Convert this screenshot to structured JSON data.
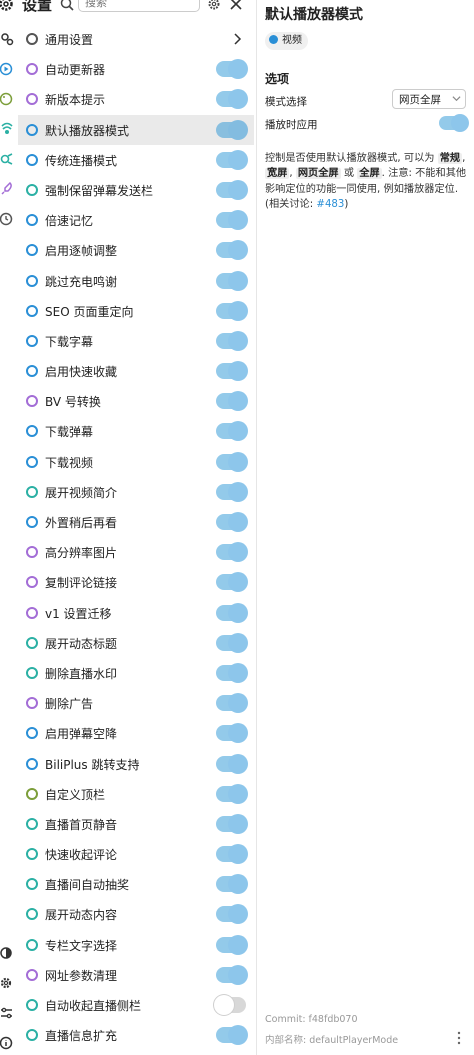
{
  "header": {
    "title": "设置",
    "search_placeholder": "搜索"
  },
  "list": [
    {
      "label": "通用设置",
      "ring": "#555555",
      "type": "nav"
    },
    {
      "label": "自动更新器",
      "ring": "#a36dd6",
      "type": "toggle",
      "on": true
    },
    {
      "label": "新版本提示",
      "ring": "#a36dd6",
      "type": "toggle",
      "on": true
    },
    {
      "label": "默认播放器模式",
      "ring": "#2a8fd6",
      "type": "toggle",
      "on": true,
      "active": true
    },
    {
      "label": "传统连播模式",
      "ring": "#2a8fd6",
      "type": "toggle",
      "on": true
    },
    {
      "label": "强制保留弹幕发送栏",
      "ring": "#2bb0a4",
      "type": "toggle",
      "on": true
    },
    {
      "label": "倍速记忆",
      "ring": "#2a8fd6",
      "type": "toggle",
      "on": true
    },
    {
      "label": "启用逐帧调整",
      "ring": "#2a8fd6",
      "type": "toggle",
      "on": true
    },
    {
      "label": "跳过充电鸣谢",
      "ring": "#2a8fd6",
      "type": "toggle",
      "on": true
    },
    {
      "label": "SEO 页面重定向",
      "ring": "#2a8fd6",
      "type": "toggle",
      "on": true
    },
    {
      "label": "下载字幕",
      "ring": "#2a8fd6",
      "type": "toggle",
      "on": true
    },
    {
      "label": "启用快速收藏",
      "ring": "#2a8fd6",
      "type": "toggle",
      "on": true
    },
    {
      "label": "BV 号转换",
      "ring": "#a36dd6",
      "type": "toggle",
      "on": true
    },
    {
      "label": "下载弹幕",
      "ring": "#2a8fd6",
      "type": "toggle",
      "on": true
    },
    {
      "label": "下载视频",
      "ring": "#2a8fd6",
      "type": "toggle",
      "on": true
    },
    {
      "label": "展开视频简介",
      "ring": "#2bb0a4",
      "type": "toggle",
      "on": true
    },
    {
      "label": "外置稍后再看",
      "ring": "#2a8fd6",
      "type": "toggle",
      "on": true
    },
    {
      "label": "高分辨率图片",
      "ring": "#a36dd6",
      "type": "toggle",
      "on": true
    },
    {
      "label": "复制评论链接",
      "ring": "#a36dd6",
      "type": "toggle",
      "on": true
    },
    {
      "label": "v1 设置迁移",
      "ring": "#a36dd6",
      "type": "toggle",
      "on": true
    },
    {
      "label": "展开动态标题",
      "ring": "#2bb0a4",
      "type": "toggle",
      "on": true
    },
    {
      "label": "删除直播水印",
      "ring": "#2bb0a4",
      "type": "toggle",
      "on": true
    },
    {
      "label": "删除广告",
      "ring": "#a36dd6",
      "type": "toggle",
      "on": true
    },
    {
      "label": "启用弹幕空降",
      "ring": "#2a8fd6",
      "type": "toggle",
      "on": true
    },
    {
      "label": "BiliPlus 跳转支持",
      "ring": "#2a8fd6",
      "type": "toggle",
      "on": true
    },
    {
      "label": "自定义顶栏",
      "ring": "#7c9e3a",
      "type": "toggle",
      "on": true
    },
    {
      "label": "直播首页静音",
      "ring": "#2bb0a4",
      "type": "toggle",
      "on": true
    },
    {
      "label": "快速收起评论",
      "ring": "#2bb0a4",
      "type": "toggle",
      "on": true
    },
    {
      "label": "直播间自动抽奖",
      "ring": "#2bb0a4",
      "type": "toggle",
      "on": true
    },
    {
      "label": "展开动态内容",
      "ring": "#2bb0a4",
      "type": "toggle",
      "on": true
    },
    {
      "label": "专栏文字选择",
      "ring": "#2bb0a4",
      "type": "toggle",
      "on": true
    },
    {
      "label": "网址参数清理",
      "ring": "#a36dd6",
      "type": "toggle",
      "on": true
    },
    {
      "label": "自动收起直播侧栏",
      "ring": "#2bb0a4",
      "type": "toggle",
      "on": false
    },
    {
      "label": "直播信息扩充",
      "ring": "#2bb0a4",
      "type": "toggle",
      "on": true
    }
  ],
  "detail": {
    "title": "默认播放器模式",
    "tag": "视频",
    "section": "选项",
    "option1_label": "模式选择",
    "option1_value": "网页全屏",
    "option2_label": "播放时应用",
    "option2_on": true,
    "desc_parts": [
      {
        "t": "控制是否使用默认播放器模式, 可以为 "
      },
      {
        "t": "常规",
        "kw": true
      },
      {
        "t": ", "
      },
      {
        "t": "宽屏",
        "kw": true
      },
      {
        "t": ", "
      },
      {
        "t": "网页全屏",
        "kw": true
      },
      {
        "t": " 或 "
      },
      {
        "t": "全屏",
        "kw": true
      },
      {
        "t": ". 注意: 不能和其他影响定位的功能一同使用, 例如播放器定位. (相关讨论: "
      },
      {
        "t": "#483",
        "link": true
      },
      {
        "t": ")"
      }
    ],
    "commit": "Commit: f48fdb070",
    "inner_name": "内部名称: defaultPlayerMode"
  },
  "colors": {
    "accent": "#2a8fd6"
  }
}
